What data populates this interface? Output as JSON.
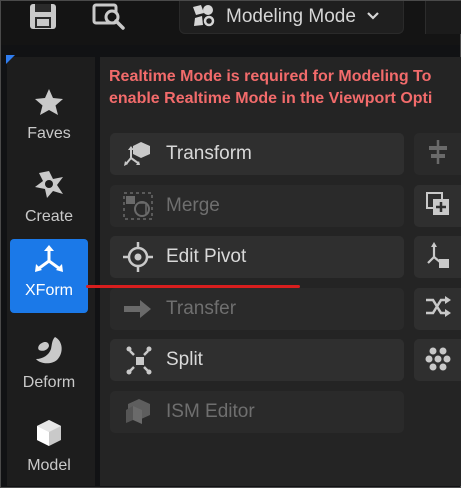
{
  "toolbar": {
    "save_icon": "save-icon",
    "content_browser_icon": "content-browser-icon",
    "mode_label": "Modeling Mode",
    "mode_icon": "modeling-mode-icon",
    "chevron_icon": "chevron-down-icon"
  },
  "warning": {
    "line1": "Realtime Mode is required for Modeling To",
    "line2": "enable Realtime Mode in the Viewport Opti"
  },
  "sidebar": {
    "items": [
      {
        "label": "Faves",
        "icon": "star-icon",
        "active": false
      },
      {
        "label": "Create",
        "icon": "create-shape-icon",
        "active": false
      },
      {
        "label": "XForm",
        "icon": "xform-axes-icon",
        "active": true
      },
      {
        "label": "Deform",
        "icon": "deform-icon",
        "active": false
      },
      {
        "label": "Model",
        "icon": "model-cube-icon",
        "active": false
      }
    ]
  },
  "tools": [
    {
      "label": "Transform",
      "icon": "transform-icon",
      "enabled": true
    },
    {
      "label": "Merge",
      "icon": "merge-icon",
      "enabled": false
    },
    {
      "label": "Edit Pivot",
      "icon": "edit-pivot-icon",
      "enabled": true
    },
    {
      "label": "Transfer",
      "icon": "transfer-arrow-icon",
      "enabled": false
    },
    {
      "label": "Split",
      "icon": "split-icon",
      "enabled": true
    },
    {
      "label": "ISM Editor",
      "icon": "ism-editor-icon",
      "enabled": false
    }
  ],
  "right_tools": [
    {
      "icon": "align-icon",
      "enabled": false
    },
    {
      "icon": "duplicate-icon",
      "enabled": true
    },
    {
      "icon": "bake-transform-icon",
      "enabled": true
    },
    {
      "icon": "shuffle-icon",
      "enabled": true
    },
    {
      "icon": "pattern-dots-icon",
      "enabled": true
    }
  ],
  "colors": {
    "accent": "#1b79e8",
    "warning_text": "#f26b6b",
    "annotation_line": "#d81e1e"
  }
}
